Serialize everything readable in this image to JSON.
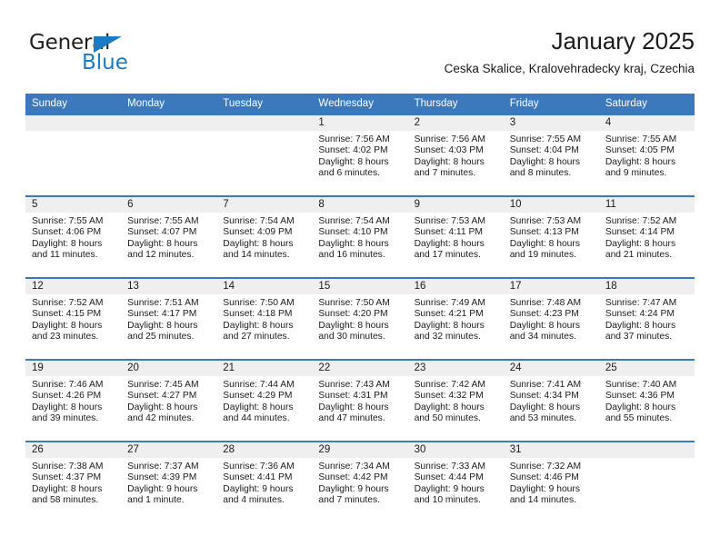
{
  "brand": {
    "word_one": "General",
    "word_two": "Blue",
    "triangle_color": "#1a7ac4",
    "blue_color": "#1a7ac4",
    "dark_color": "#231f20"
  },
  "header": {
    "title": "January 2025",
    "subtitle": "Ceska Skalice, Kralovehradecky kraj, Czechia"
  },
  "theme": {
    "header_blue": "#3b78bc",
    "daynum_band": "#efefef",
    "text": "#1b1b1b"
  },
  "weekdays": [
    "Sunday",
    "Monday",
    "Tuesday",
    "Wednesday",
    "Thursday",
    "Friday",
    "Saturday"
  ],
  "weeks": [
    [
      {
        "day": "",
        "l1": "",
        "l2": "",
        "l3": "",
        "l4": ""
      },
      {
        "day": "",
        "l1": "",
        "l2": "",
        "l3": "",
        "l4": ""
      },
      {
        "day": "",
        "l1": "",
        "l2": "",
        "l3": "",
        "l4": ""
      },
      {
        "day": "1",
        "l1": "Sunrise: 7:56 AM",
        "l2": "Sunset: 4:02 PM",
        "l3": "Daylight: 8 hours",
        "l4": "and 6 minutes."
      },
      {
        "day": "2",
        "l1": "Sunrise: 7:56 AM",
        "l2": "Sunset: 4:03 PM",
        "l3": "Daylight: 8 hours",
        "l4": "and 7 minutes."
      },
      {
        "day": "3",
        "l1": "Sunrise: 7:55 AM",
        "l2": "Sunset: 4:04 PM",
        "l3": "Daylight: 8 hours",
        "l4": "and 8 minutes."
      },
      {
        "day": "4",
        "l1": "Sunrise: 7:55 AM",
        "l2": "Sunset: 4:05 PM",
        "l3": "Daylight: 8 hours",
        "l4": "and 9 minutes."
      }
    ],
    [
      {
        "day": "5",
        "l1": "Sunrise: 7:55 AM",
        "l2": "Sunset: 4:06 PM",
        "l3": "Daylight: 8 hours",
        "l4": "and 11 minutes."
      },
      {
        "day": "6",
        "l1": "Sunrise: 7:55 AM",
        "l2": "Sunset: 4:07 PM",
        "l3": "Daylight: 8 hours",
        "l4": "and 12 minutes."
      },
      {
        "day": "7",
        "l1": "Sunrise: 7:54 AM",
        "l2": "Sunset: 4:09 PM",
        "l3": "Daylight: 8 hours",
        "l4": "and 14 minutes."
      },
      {
        "day": "8",
        "l1": "Sunrise: 7:54 AM",
        "l2": "Sunset: 4:10 PM",
        "l3": "Daylight: 8 hours",
        "l4": "and 16 minutes."
      },
      {
        "day": "9",
        "l1": "Sunrise: 7:53 AM",
        "l2": "Sunset: 4:11 PM",
        "l3": "Daylight: 8 hours",
        "l4": "and 17 minutes."
      },
      {
        "day": "10",
        "l1": "Sunrise: 7:53 AM",
        "l2": "Sunset: 4:13 PM",
        "l3": "Daylight: 8 hours",
        "l4": "and 19 minutes."
      },
      {
        "day": "11",
        "l1": "Sunrise: 7:52 AM",
        "l2": "Sunset: 4:14 PM",
        "l3": "Daylight: 8 hours",
        "l4": "and 21 minutes."
      }
    ],
    [
      {
        "day": "12",
        "l1": "Sunrise: 7:52 AM",
        "l2": "Sunset: 4:15 PM",
        "l3": "Daylight: 8 hours",
        "l4": "and 23 minutes."
      },
      {
        "day": "13",
        "l1": "Sunrise: 7:51 AM",
        "l2": "Sunset: 4:17 PM",
        "l3": "Daylight: 8 hours",
        "l4": "and 25 minutes."
      },
      {
        "day": "14",
        "l1": "Sunrise: 7:50 AM",
        "l2": "Sunset: 4:18 PM",
        "l3": "Daylight: 8 hours",
        "l4": "and 27 minutes."
      },
      {
        "day": "15",
        "l1": "Sunrise: 7:50 AM",
        "l2": "Sunset: 4:20 PM",
        "l3": "Daylight: 8 hours",
        "l4": "and 30 minutes."
      },
      {
        "day": "16",
        "l1": "Sunrise: 7:49 AM",
        "l2": "Sunset: 4:21 PM",
        "l3": "Daylight: 8 hours",
        "l4": "and 32 minutes."
      },
      {
        "day": "17",
        "l1": "Sunrise: 7:48 AM",
        "l2": "Sunset: 4:23 PM",
        "l3": "Daylight: 8 hours",
        "l4": "and 34 minutes."
      },
      {
        "day": "18",
        "l1": "Sunrise: 7:47 AM",
        "l2": "Sunset: 4:24 PM",
        "l3": "Daylight: 8 hours",
        "l4": "and 37 minutes."
      }
    ],
    [
      {
        "day": "19",
        "l1": "Sunrise: 7:46 AM",
        "l2": "Sunset: 4:26 PM",
        "l3": "Daylight: 8 hours",
        "l4": "and 39 minutes."
      },
      {
        "day": "20",
        "l1": "Sunrise: 7:45 AM",
        "l2": "Sunset: 4:27 PM",
        "l3": "Daylight: 8 hours",
        "l4": "and 42 minutes."
      },
      {
        "day": "21",
        "l1": "Sunrise: 7:44 AM",
        "l2": "Sunset: 4:29 PM",
        "l3": "Daylight: 8 hours",
        "l4": "and 44 minutes."
      },
      {
        "day": "22",
        "l1": "Sunrise: 7:43 AM",
        "l2": "Sunset: 4:31 PM",
        "l3": "Daylight: 8 hours",
        "l4": "and 47 minutes."
      },
      {
        "day": "23",
        "l1": "Sunrise: 7:42 AM",
        "l2": "Sunset: 4:32 PM",
        "l3": "Daylight: 8 hours",
        "l4": "and 50 minutes."
      },
      {
        "day": "24",
        "l1": "Sunrise: 7:41 AM",
        "l2": "Sunset: 4:34 PM",
        "l3": "Daylight: 8 hours",
        "l4": "and 53 minutes."
      },
      {
        "day": "25",
        "l1": "Sunrise: 7:40 AM",
        "l2": "Sunset: 4:36 PM",
        "l3": "Daylight: 8 hours",
        "l4": "and 55 minutes."
      }
    ],
    [
      {
        "day": "26",
        "l1": "Sunrise: 7:38 AM",
        "l2": "Sunset: 4:37 PM",
        "l3": "Daylight: 8 hours",
        "l4": "and 58 minutes."
      },
      {
        "day": "27",
        "l1": "Sunrise: 7:37 AM",
        "l2": "Sunset: 4:39 PM",
        "l3": "Daylight: 9 hours",
        "l4": "and 1 minute."
      },
      {
        "day": "28",
        "l1": "Sunrise: 7:36 AM",
        "l2": "Sunset: 4:41 PM",
        "l3": "Daylight: 9 hours",
        "l4": "and 4 minutes."
      },
      {
        "day": "29",
        "l1": "Sunrise: 7:34 AM",
        "l2": "Sunset: 4:42 PM",
        "l3": "Daylight: 9 hours",
        "l4": "and 7 minutes."
      },
      {
        "day": "30",
        "l1": "Sunrise: 7:33 AM",
        "l2": "Sunset: 4:44 PM",
        "l3": "Daylight: 9 hours",
        "l4": "and 10 minutes."
      },
      {
        "day": "31",
        "l1": "Sunrise: 7:32 AM",
        "l2": "Sunset: 4:46 PM",
        "l3": "Daylight: 9 hours",
        "l4": "and 14 minutes."
      },
      {
        "day": "",
        "l1": "",
        "l2": "",
        "l3": "",
        "l4": ""
      }
    ]
  ]
}
